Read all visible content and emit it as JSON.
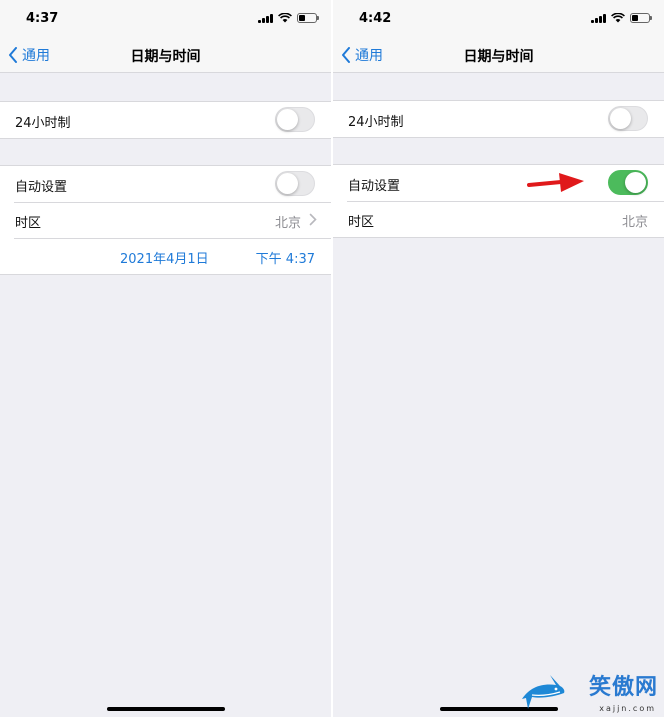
{
  "left": {
    "status": {
      "time": "4:37"
    },
    "nav": {
      "back_label": "通用",
      "title": "日期与时间"
    },
    "rows": {
      "hour24_label": "24小时制",
      "hour24_on": false,
      "auto_label": "自动设置",
      "auto_on": false,
      "timezone_label": "时区",
      "timezone_value": "北京",
      "date_value": "2021年4月1日",
      "time_value": "下午 4:37"
    }
  },
  "right": {
    "status": {
      "time": "4:42"
    },
    "nav": {
      "back_label": "通用",
      "title": "日期与时间"
    },
    "rows": {
      "hour24_label": "24小时制",
      "hour24_on": false,
      "auto_label": "自动设置",
      "auto_on": true,
      "timezone_label": "时区",
      "timezone_value": "北京"
    }
  },
  "watermark": {
    "text": "笑傲网",
    "domain": "xajjn.com"
  },
  "colors": {
    "tint": "#1f7ad8",
    "toggle_on": "#4cbb5c",
    "arrow": "#e0191b",
    "background": "#efeff4"
  },
  "icons": [
    "chevron-left-icon",
    "chevron-right-icon",
    "signal-icon",
    "wifi-icon",
    "battery-icon",
    "red-arrow-icon",
    "shark-logo-icon"
  ]
}
